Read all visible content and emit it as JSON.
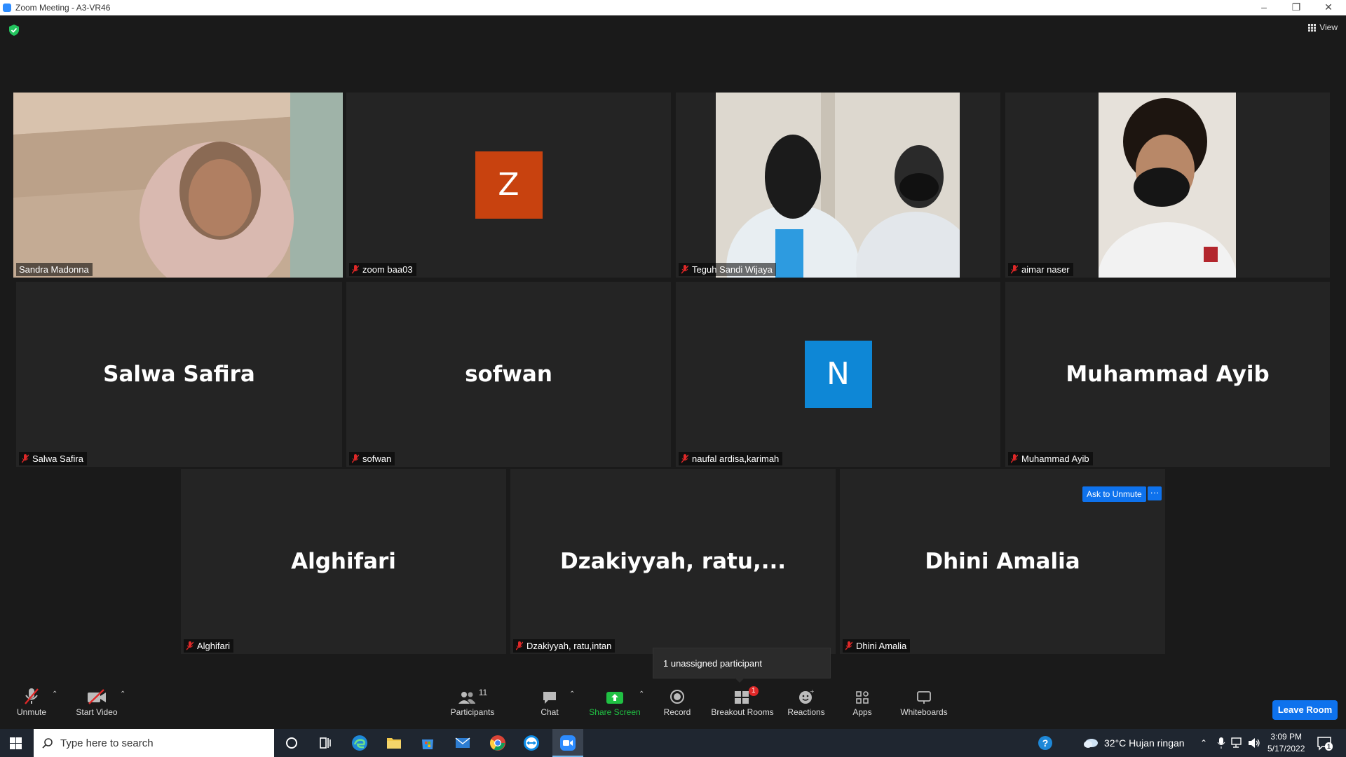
{
  "window": {
    "title": "Zoom Meeting - A3-VR46"
  },
  "topbar": {
    "view_label": "View"
  },
  "tiles": [
    {
      "name": "Sandra Madonna",
      "type": "video",
      "active": true
    },
    {
      "name": "zoom baa03",
      "type": "avatar",
      "avatar_letter": "Z",
      "avatar_color": "#c8420f"
    },
    {
      "name": "Teguh Sandi Wijaya",
      "type": "video"
    },
    {
      "name": "aimar naser",
      "type": "video"
    },
    {
      "name": "Salwa Safira",
      "display_name": "Salwa Safira",
      "type": "name"
    },
    {
      "name": "sofwan",
      "display_name": "sofwan",
      "type": "name"
    },
    {
      "name": "naufal ardisa,karimah",
      "type": "avatar",
      "avatar_letter": "N",
      "avatar_color": "#0e87d6"
    },
    {
      "name": "Muhammad Ayib",
      "display_name": "Muhammad Ayib",
      "type": "name"
    },
    {
      "name": "Alghifari",
      "display_name": "Alghifari",
      "type": "name"
    },
    {
      "name": "Dzakiyyah, ratu,intan",
      "display_name": "Dzakiyyah,  ratu,...",
      "type": "name"
    },
    {
      "name": "Dhini Amalia",
      "display_name": "Dhini Amalia",
      "type": "name"
    }
  ],
  "hover_actions": {
    "ask_to_unmute": "Ask to Unmute",
    "more": "···"
  },
  "tooltip": {
    "text": "1 unassigned participant"
  },
  "toolbar": {
    "unmute": "Unmute",
    "start_video": "Start Video",
    "participants": "Participants",
    "participants_count": "11",
    "chat": "Chat",
    "share_screen": "Share Screen",
    "record": "Record",
    "breakout_rooms": "Breakout Rooms",
    "breakout_badge": "1",
    "reactions": "Reactions",
    "apps": "Apps",
    "whiteboards": "Whiteboards",
    "leave_room": "Leave Room"
  },
  "taskbar": {
    "search_placeholder": "Type here to search",
    "weather": "32°C  Hujan ringan",
    "time": "3:09 PM",
    "date": "5/17/2022",
    "notification_count": "1"
  },
  "colors": {
    "accent": "#0e72ed",
    "share_green": "#20c043",
    "active_border": "#c8e36a",
    "badge_red": "#e02828"
  }
}
